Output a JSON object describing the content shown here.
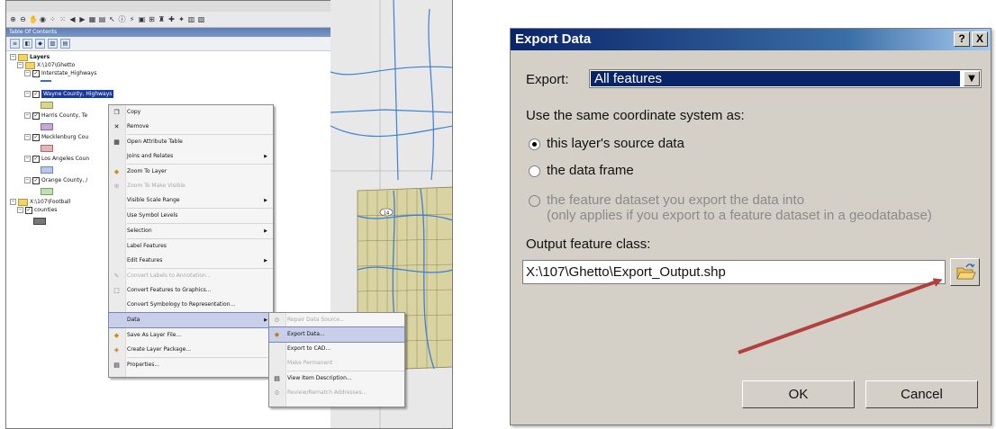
{
  "arcmap": {
    "toc_title": "Table Of Contents",
    "layers": [
      {
        "label": "Layers"
      },
      {
        "label": "X:\\107\\Ghetto"
      },
      {
        "label": "Interstate_Highways"
      },
      {
        "label": "Wayne County, Highways"
      },
      {
        "label": "Harris County, Te"
      },
      {
        "label": "Mecklenburg Cou"
      },
      {
        "label": "Los Angeles Coun"
      },
      {
        "label": "Orange County, /"
      },
      {
        "label": "X:\\107\\Football"
      },
      {
        "label": "counties"
      }
    ],
    "map_badge": "14",
    "context_menu": [
      {
        "label": "Copy"
      },
      {
        "label": "Remove"
      },
      {
        "label": "Open Attribute Table"
      },
      {
        "label": "Joins and Relates"
      },
      {
        "label": "Zoom To Layer"
      },
      {
        "label": "Zoom To Make Visible"
      },
      {
        "label": "Visible Scale Range"
      },
      {
        "label": "Use Symbol Levels"
      },
      {
        "label": "Selection"
      },
      {
        "label": "Label Features"
      },
      {
        "label": "Edit Features"
      },
      {
        "label": "Convert Labels to Annotation..."
      },
      {
        "label": "Convert Features to Graphics..."
      },
      {
        "label": "Convert Symbology to Representation..."
      },
      {
        "label": "Data"
      },
      {
        "label": "Save As Layer File..."
      },
      {
        "label": "Create Layer Package..."
      },
      {
        "label": "Properties..."
      }
    ],
    "data_submenu": [
      {
        "label": "Repair Data Source..."
      },
      {
        "label": "Export Data..."
      },
      {
        "label": "Export to CAD..."
      },
      {
        "label": "Make Permanent"
      },
      {
        "label": "View Item Description..."
      },
      {
        "label": "Review/Rematch Addresses..."
      }
    ]
  },
  "dialog": {
    "title": "Export Data",
    "help_label": "?",
    "close_label": "X",
    "export_label": "Export:",
    "export_value": "All features",
    "coord_label": "Use the same coordinate system as:",
    "option_source": "this layer's source data",
    "option_frame": "the data frame",
    "option_dataset_line1": "the feature dataset you export the data into",
    "option_dataset_line2": "(only applies if you export to a feature dataset in a geodatabase)",
    "output_label": "Output feature class:",
    "output_value": "X:\\107\\Ghetto\\Export_Output.shp",
    "ok_label": "OK",
    "cancel_label": "Cancel"
  },
  "colors": {
    "titlebar": "#0a246a",
    "selection": "#1b3aa0",
    "arrow": "#b0413e",
    "map_land": "#d9d3a2",
    "roads": "#3b7fd6"
  }
}
